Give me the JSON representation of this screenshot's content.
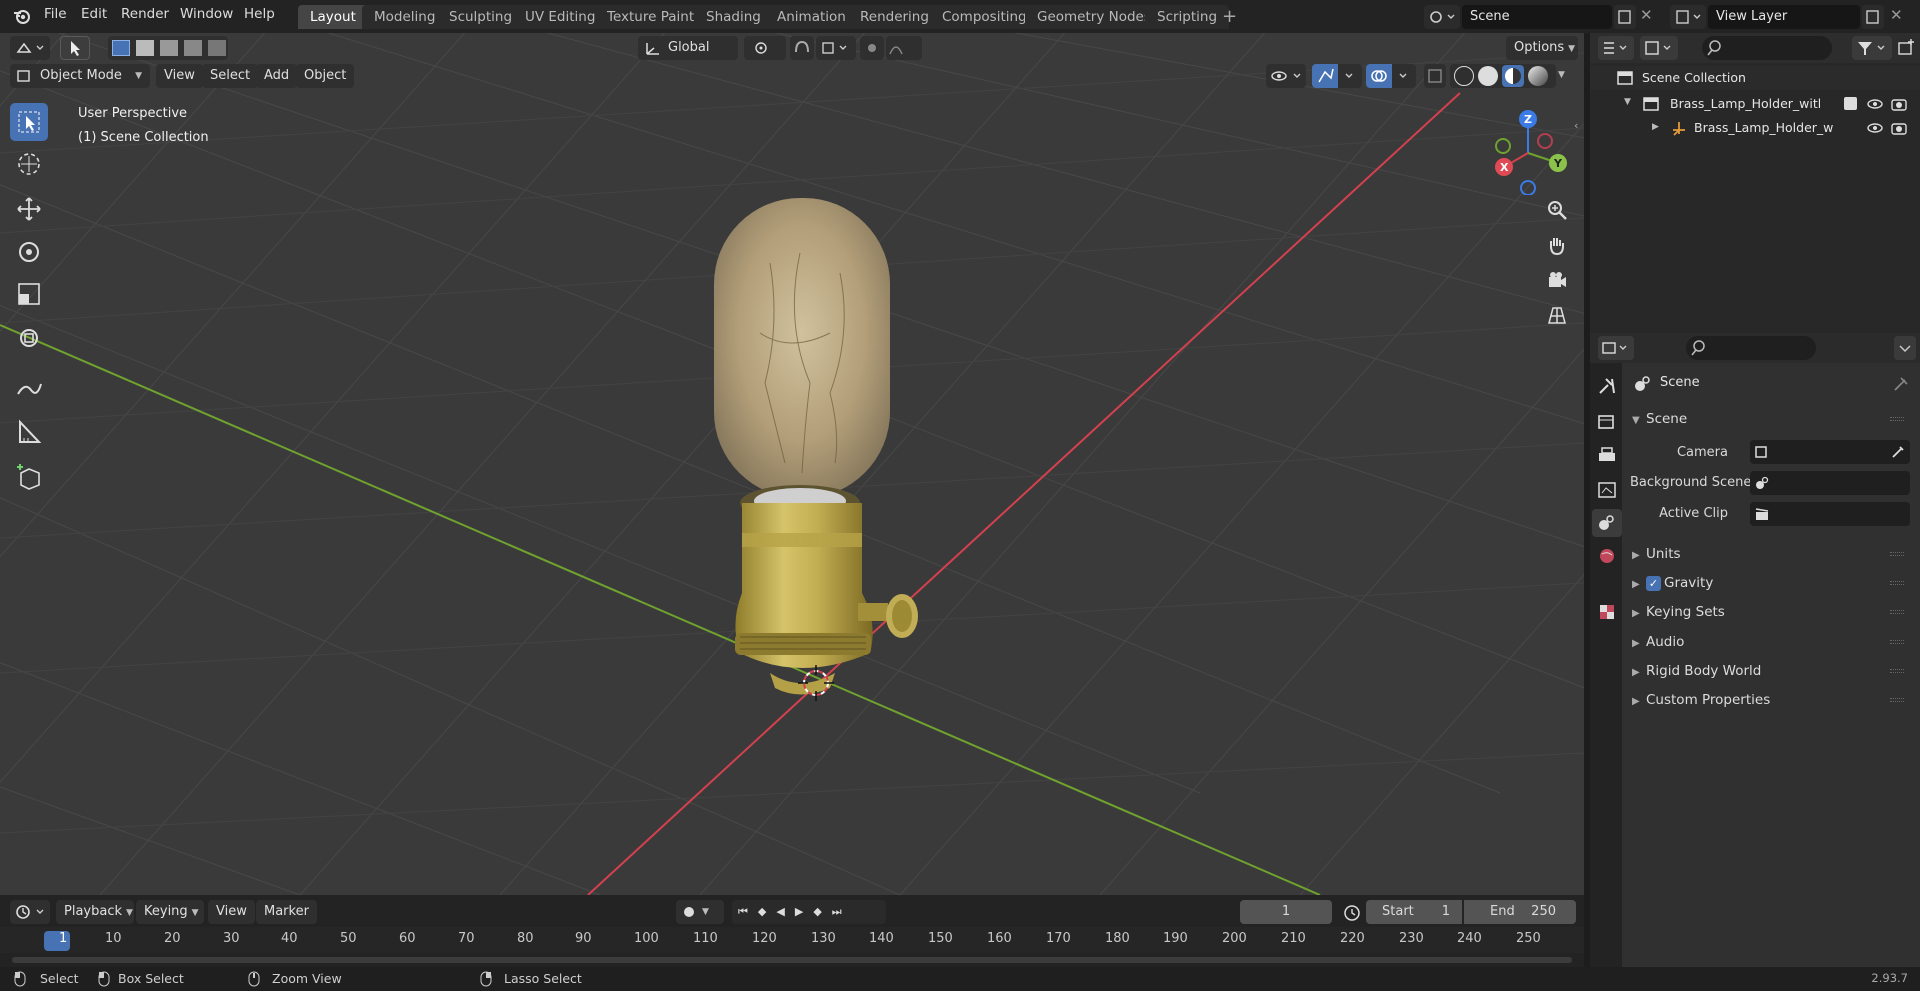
{
  "app": {
    "name": "Blender",
    "version": "2.93.7"
  },
  "menu": [
    "File",
    "Edit",
    "Render",
    "Window",
    "Help"
  ],
  "workspaces": [
    {
      "label": "Layout",
      "active": true
    },
    {
      "label": "Modeling"
    },
    {
      "label": "Sculpting"
    },
    {
      "label": "UV Editing"
    },
    {
      "label": "Texture Paint"
    },
    {
      "label": "Shading"
    },
    {
      "label": "Animation"
    },
    {
      "label": "Rendering"
    },
    {
      "label": "Compositing"
    },
    {
      "label": "Geometry Nodes"
    },
    {
      "label": "Scripting"
    }
  ],
  "scene_selector": {
    "value": "Scene"
  },
  "view_layer_selector": {
    "value": "View Layer"
  },
  "viewport": {
    "mode": "Object Mode",
    "header_menus": [
      "View",
      "Select",
      "Add",
      "Object"
    ],
    "transform_orientation": "Global",
    "options_label": "Options",
    "overlay_text_1": "User Perspective",
    "overlay_text_2": "(1) Scene Collection",
    "gizmo_axes": {
      "x": "X",
      "y": "Y",
      "z": "Z"
    }
  },
  "outliner": {
    "root": "Scene Collection",
    "items": [
      {
        "label": "Brass_Lamp_Holder_with_Lig",
        "type": "collection"
      },
      {
        "label": "Brass_Lamp_Holder_with",
        "type": "object"
      }
    ]
  },
  "properties": {
    "title": "Scene",
    "section": "Scene",
    "fields": [
      {
        "label": "Camera",
        "value": ""
      },
      {
        "label": "Background Scene",
        "value": ""
      },
      {
        "label": "Active Clip",
        "value": ""
      }
    ],
    "panels": [
      "Units",
      "Gravity",
      "Keying Sets",
      "Audio",
      "Rigid Body World",
      "Custom Properties"
    ],
    "gravity_checked": true
  },
  "timeline": {
    "menus": [
      "Playback",
      "Keying",
      "View",
      "Marker"
    ],
    "current_frame": "1",
    "start_label": "Start",
    "start_value": "1",
    "end_label": "End",
    "end_value": "250",
    "ticks": [
      "1",
      "10",
      "20",
      "30",
      "40",
      "50",
      "60",
      "70",
      "80",
      "90",
      "100",
      "110",
      "120",
      "130",
      "140",
      "150",
      "160",
      "170",
      "180",
      "190",
      "200",
      "210",
      "220",
      "230",
      "240",
      "250"
    ]
  },
  "statusbar": {
    "items": [
      "Select",
      "Box Select",
      "Zoom View",
      "Lasso Select"
    ],
    "version": "2.93.7"
  },
  "colors": {
    "accent": "#4772b3",
    "x_axis": "#d3414e",
    "y_axis": "#6fa22e",
    "z_axis": "#3a7be6"
  }
}
